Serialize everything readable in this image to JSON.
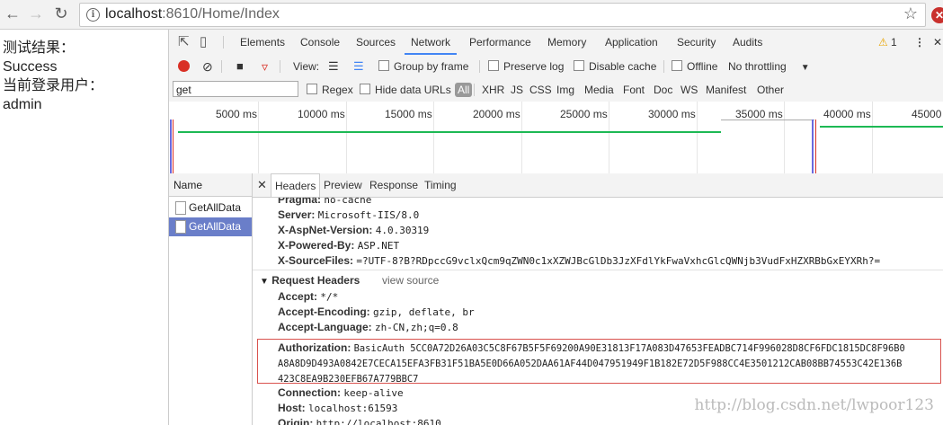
{
  "browser": {
    "back_icon": "arrow-left",
    "forward_icon": "arrow-right",
    "reload_icon": "reload",
    "url_host": "localhost",
    "url_rest": ":8610/Home/Index",
    "star_icon": "star"
  },
  "page": {
    "line1": "测试结果：",
    "line2": "Success",
    "line3": "当前登录用户：",
    "line4": "admin"
  },
  "devtools": {
    "tabs": [
      "Elements",
      "Console",
      "Sources",
      "Network",
      "Performance",
      "Memory",
      "Application",
      "Security",
      "Audits"
    ],
    "active_tab": "Network",
    "warning_count": "1",
    "toolbar": {
      "view_label": "View:",
      "group_by_frame": "Group by frame",
      "preserve_log": "Preserve log",
      "disable_cache": "Disable cache",
      "offline": "Offline",
      "throttling": "No throttling"
    },
    "filter": {
      "value": "get",
      "regex": "Regex",
      "hide_data_urls": "Hide data URLs",
      "types": [
        "All",
        "XHR",
        "JS",
        "CSS",
        "Img",
        "Media",
        "Font",
        "Doc",
        "WS",
        "Manifest",
        "Other"
      ]
    },
    "timeline_ticks": [
      "5000 ms",
      "10000 ms",
      "15000 ms",
      "20000 ms",
      "25000 ms",
      "30000 ms",
      "35000 ms",
      "40000 ms",
      "45000"
    ],
    "name_header": "Name",
    "requests": [
      "GetAllData",
      "GetAllData"
    ],
    "detail_tabs": [
      "Headers",
      "Preview",
      "Response",
      "Timing"
    ],
    "response_headers": [
      {
        "key": "Pragma:",
        "value": "no-cache"
      },
      {
        "key": "Server:",
        "value": "Microsoft-IIS/8.0"
      },
      {
        "key": "X-AspNet-Version:",
        "value": "4.0.30319"
      },
      {
        "key": "X-Powered-By:",
        "value": "ASP.NET"
      },
      {
        "key": "X-SourceFiles:",
        "value": "=?UTF-8?B?RDpccG9vclxQcm9qZWN0c1xXZWJBcGlDb3JzXFdlYkFwaVxhcGlcQWNjb3VudFxHZXRBbGxEYXRh?="
      }
    ],
    "request_headers_title": "Request Headers",
    "view_source": "view source",
    "request_headers": [
      {
        "key": "Accept:",
        "value": "*/*"
      },
      {
        "key": "Accept-Encoding:",
        "value": "gzip, deflate, br"
      },
      {
        "key": "Accept-Language:",
        "value": "zh-CN,zh;q=0.8"
      }
    ],
    "authorization": {
      "key": "Authorization:",
      "line1": "BasicAuth 5CC0A72D26A03C5C8F67B5F5F69200A90E31813F17A083D47653FEADBC714F996028D8CF6FDC1815DC8F96B0",
      "line2": "A8A8D9D493A0842E7CECA15EFA3FB31F51BA5E0D66A052DAA61AF44D047951949F1B182E72D5F988CC4E3501212CAB08BB74553C42E136B",
      "line3": "423C8EA9B230EFB67A779BBC7"
    },
    "after_headers": [
      {
        "key": "Connection:",
        "value": "keep-alive"
      },
      {
        "key": "Host:",
        "value": "localhost:61593"
      },
      {
        "key": "Origin:",
        "value": "http://localhost:8610"
      }
    ]
  },
  "watermark": "http://blog.csdn.net/lwpoor123"
}
